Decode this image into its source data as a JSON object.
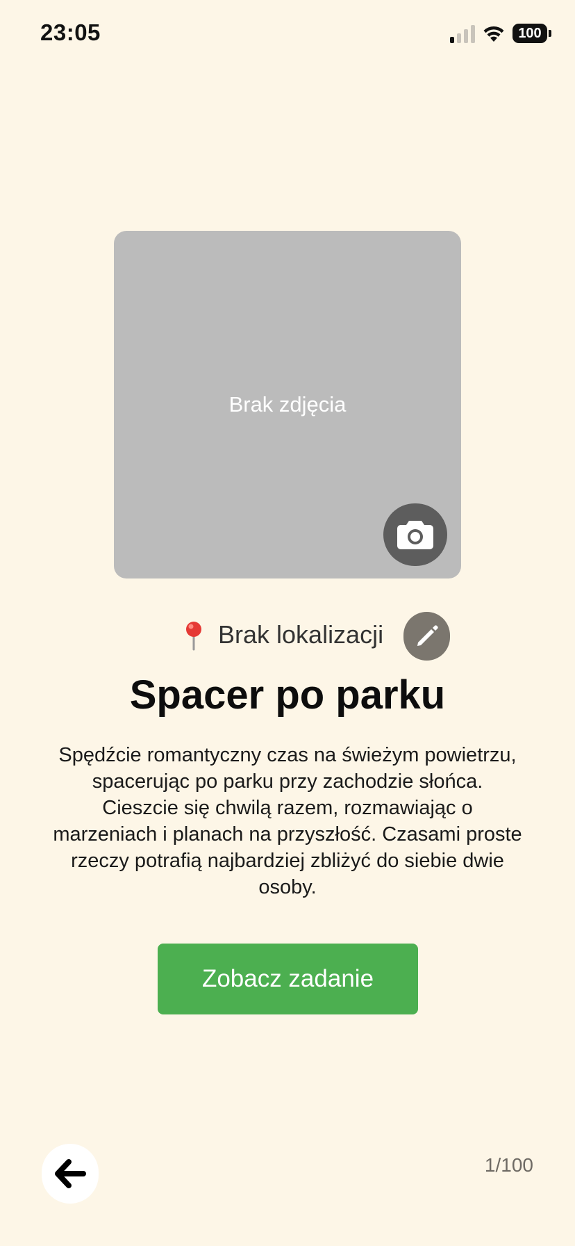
{
  "status_bar": {
    "time": "23:05",
    "battery_level": "100",
    "icons": [
      "cellular-signal-icon",
      "wifi-icon",
      "battery-icon"
    ]
  },
  "photo": {
    "placeholder_text": "Brak zdjęcia",
    "camera_icon": "camera-icon"
  },
  "location": {
    "pin_icon": "pin-icon",
    "text": "Brak lokalizacji",
    "edit_icon": "pencil-icon"
  },
  "task": {
    "title": "Spacer po parku",
    "description": "Spędźcie romantyczny czas na świeżym powietrzu, spacerując po parku przy zachodzie słońca. Cieszcie się chwilą razem, rozmawiając o marzeniach i planach na przyszłość. Czasami proste rzeczy potrafią najbardziej zbliżyć do siebie dwie osoby."
  },
  "actions": {
    "view_task_label": "Zobacz zadanie",
    "back_icon": "arrow-left-icon"
  },
  "progress": {
    "counter": "1/100"
  },
  "colors": {
    "background": "#fdf6e7",
    "primary_button": "#4caf50",
    "photo_placeholder": "#bbbbbb",
    "camera_button": "#5d5d5d",
    "edit_button": "#7b766e"
  }
}
